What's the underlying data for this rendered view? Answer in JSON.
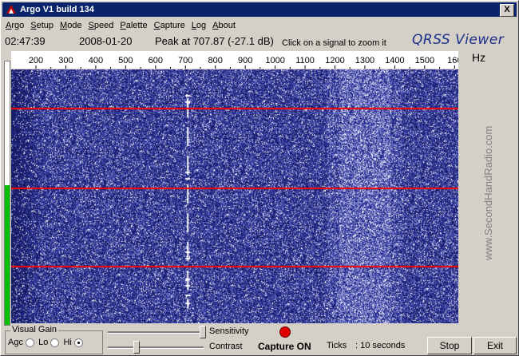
{
  "window": {
    "title": "Argo V1 build 134",
    "close_label": "X"
  },
  "menu": [
    {
      "label": "Argo",
      "key": "A",
      "rest": "rgo"
    },
    {
      "label": "Setup",
      "key": "S",
      "rest": "etup"
    },
    {
      "label": "Mode",
      "key": "M",
      "rest": "ode"
    },
    {
      "label": "Speed",
      "key": "S",
      "rest": "peed"
    },
    {
      "label": "Palette",
      "key": "P",
      "rest": "alette"
    },
    {
      "label": "Capture",
      "key": "C",
      "rest": "apture"
    },
    {
      "label": "Log",
      "key": "L",
      "rest": "og"
    },
    {
      "label": "About",
      "key": "A",
      "rest": "bout"
    }
  ],
  "status": {
    "time": "02:47:39",
    "date": "2008-01-20",
    "peak": "Peak at 707.87 (-27.1 dB)",
    "hint": "Click on a signal to zoom it",
    "logo": "QRSS Viewer"
  },
  "scale": {
    "unit": "Hz",
    "ticks": [
      "200",
      "300",
      "400",
      "500",
      "600",
      "700",
      "800",
      "900",
      "1000",
      "1100",
      "1200",
      "1300",
      "1400",
      "1500",
      "160"
    ]
  },
  "waterfall": {
    "signal_hz": 707.87
  },
  "watermark": "www.SecondHandRadio.com",
  "level_meter": {
    "fill_fraction": 0.53
  },
  "visual_gain": {
    "label": "Visual Gain",
    "options": [
      {
        "label": "Agc",
        "selected": false
      },
      {
        "label": "Lo",
        "selected": false
      },
      {
        "label": "Hi",
        "selected": true
      }
    ]
  },
  "sliders": {
    "sensitivity_label": "Sensitivity",
    "contrast_label": "Contrast"
  },
  "capture": {
    "status": "Capture ON",
    "indicator_color": "#e00000"
  },
  "ticks": {
    "label": "Ticks",
    "value": ": 10 seconds"
  },
  "buttons": {
    "stop": "Stop",
    "exit": "Exit"
  },
  "colors": {
    "title_bar": "#0a246a",
    "grid_lines": "#ff0000",
    "waterfall_bg": "#10186a"
  }
}
